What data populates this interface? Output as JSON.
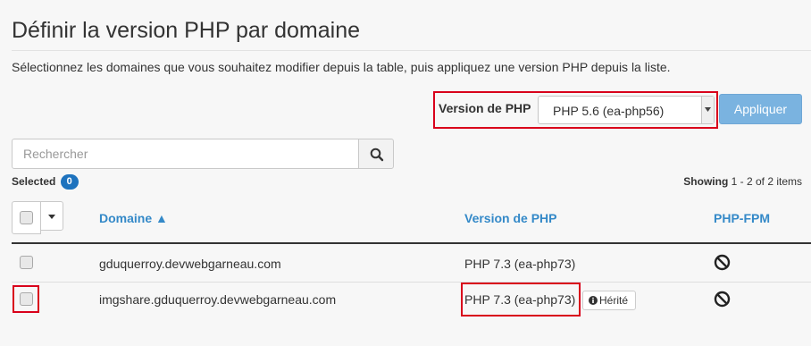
{
  "page": {
    "title": "Définir la version PHP par domaine",
    "description": "Sélectionnez les domaines que vous souhaitez modifier depuis la table, puis appliquez une version PHP depuis la liste."
  },
  "version_selector": {
    "label": "Version de PHP",
    "selected": "PHP 5.6 (ea-php56)",
    "apply_label": "Appliquer"
  },
  "search": {
    "placeholder": "Rechercher",
    "icon": "search-icon"
  },
  "selection": {
    "label": "Selected",
    "count": "0"
  },
  "showing": {
    "prefix": "Showing",
    "range": "1 - 2 of 2 items"
  },
  "table": {
    "columns": {
      "domain": "Domaine ▲",
      "php_version": "Version de PHP",
      "php_fpm": "PHP-FPM"
    },
    "rows": [
      {
        "domain": "gduquerroy.devwebgarneau.com",
        "php_version": "PHP 7.3 (ea-php73)",
        "fpm_icon": "ban-icon",
        "badge": ""
      },
      {
        "domain": "imgshare.gduquerroy.devwebgarneau.com",
        "php_version": "PHP 7.3 (ea-php73)",
        "fpm_icon": "ban-icon",
        "badge": "Hérité"
      }
    ]
  },
  "colors": {
    "accent": "#3489c8",
    "apply_button": "#7ab3e0",
    "badge": "#1e73be",
    "highlight": "#d9001b"
  }
}
